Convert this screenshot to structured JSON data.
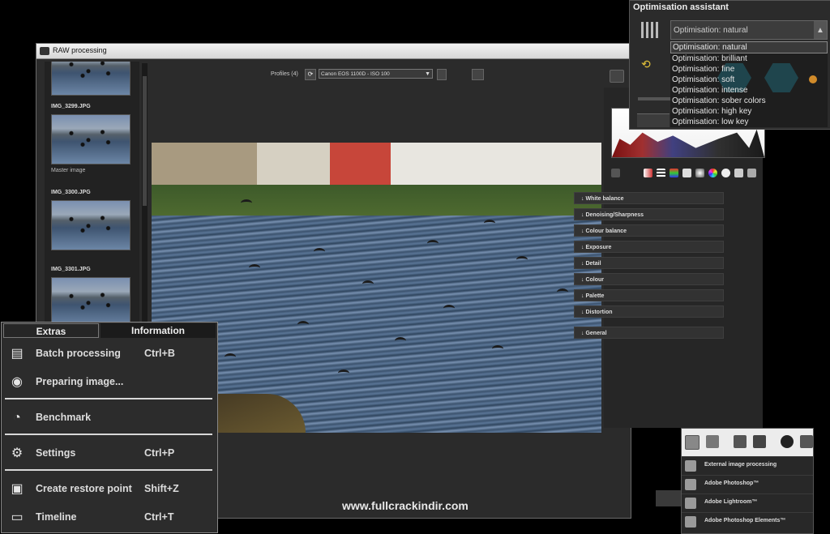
{
  "window": {
    "title": "RAW processing"
  },
  "filmstrip": {
    "items": [
      {
        "label": ""
      },
      {
        "label": "IMG_3299.JPG",
        "sublabel": "Master image"
      },
      {
        "label": "IMG_3300.JPG",
        "sublabel": ""
      },
      {
        "label": "IMG_3301.JPG",
        "sublabel": ""
      }
    ]
  },
  "toolbar": {
    "profiles_label": "Profiles (4)",
    "profile_value": "Canon EOS 1100D - ISO 100"
  },
  "adjustments": {
    "sections": [
      "White balance",
      "Denoising/Sharpness",
      "Colour balance",
      "Exposure",
      "Detail",
      "Colour",
      "Palette",
      "Distortion",
      "General"
    ]
  },
  "optimisation": {
    "title": "Optimisation assistant",
    "selected": "Optimisation: natural",
    "options": [
      "Optimisation: natural",
      "Optimisation: brilliant",
      "Optimisation: fine",
      "Optimisation: soft",
      "Optimisation: intense",
      "Optimisation: sober colors",
      "Optimisation: high key",
      "Optimisation: low key"
    ],
    "colors": {
      "hex": "#2f8fa6",
      "dot": "#d18b2a"
    }
  },
  "extras_menu": {
    "tabs": [
      "Extras",
      "Information"
    ],
    "items": [
      {
        "icon": "batch-processing-icon",
        "label": "Batch processing",
        "shortcut": "Ctrl+B"
      },
      {
        "icon": "film-reel-icon",
        "label": "Preparing image...",
        "shortcut": ""
      },
      {
        "icon": "benchmark-icon",
        "label": "Benchmark",
        "shortcut": ""
      },
      {
        "icon": "settings-gears-icon",
        "label": "Settings",
        "shortcut": "Ctrl+P"
      },
      {
        "icon": "restore-point-icon",
        "label": "Create restore point",
        "shortcut": "Shift+Z"
      },
      {
        "icon": "timeline-icon",
        "label": "Timeline",
        "shortcut": "Ctrl+T"
      }
    ]
  },
  "export_menu": {
    "items": [
      "External image processing",
      "Adobe Photoshop™",
      "Adobe Lightroom™",
      "Adobe Photoshop Elements™"
    ]
  },
  "watermark": "www.fullcrackindir.com"
}
